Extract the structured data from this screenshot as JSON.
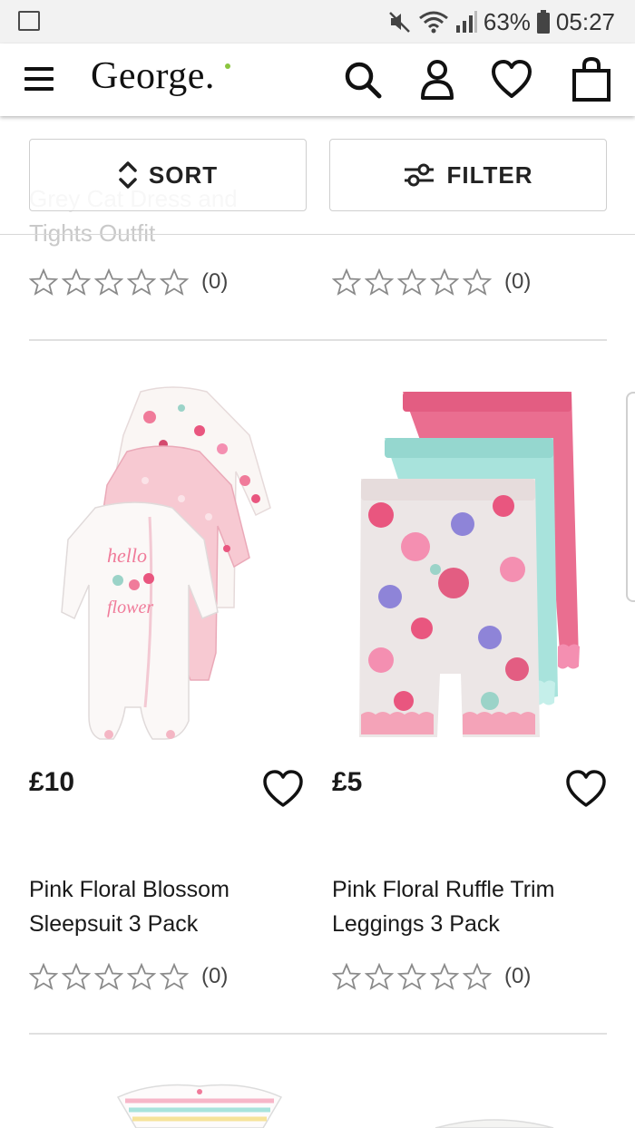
{
  "status_bar": {
    "battery": "63%",
    "time": "05:27"
  },
  "header": {
    "logo": "George."
  },
  "toolbar": {
    "sort_label": "SORT",
    "filter_label": "FILTER"
  },
  "previous_row": {
    "ghost_title": "Grey Cat Dress and Tights Outfit",
    "ratings": [
      "(0)",
      "(0)"
    ]
  },
  "products": [
    {
      "price": "£10",
      "name": "Pink Floral Blossom Sleepsuit 3 Pack",
      "rating_count": "(0)"
    },
    {
      "price": "£5",
      "name": "Pink Floral Ruffle Trim Leggings 3 Pack",
      "rating_count": "(0)"
    }
  ],
  "colors": {
    "brand_dot": "#8bc53f",
    "pink": "#e9567f",
    "mint": "#a8e3dc",
    "blush": "#f5c6cf"
  }
}
